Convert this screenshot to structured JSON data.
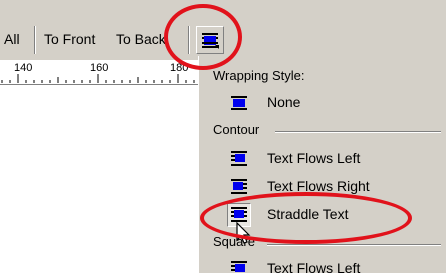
{
  "toolbar": {
    "all_label": "All",
    "to_front_label": "To Front",
    "to_back_label": "To Back",
    "wrap_button_icon": "text-wrap-icon"
  },
  "ruler": {
    "labels": [
      "140",
      "160",
      "180"
    ]
  },
  "menu": {
    "wrapping_style_header": "Wrapping Style:",
    "none_label": "None",
    "contour_header": "Contour",
    "contour_items": [
      "Text Flows Left",
      "Text Flows Right",
      "Straddle Text"
    ],
    "square_header": "Square",
    "square_items": [
      "Text Flows Left"
    ],
    "selected_item": "Straddle Text"
  },
  "colors": {
    "toolbar_bg": "#d4d0c8",
    "menu_bg": "#d4d0c8",
    "annotation": "#e1121b",
    "icon_blue": "#0000ee"
  }
}
